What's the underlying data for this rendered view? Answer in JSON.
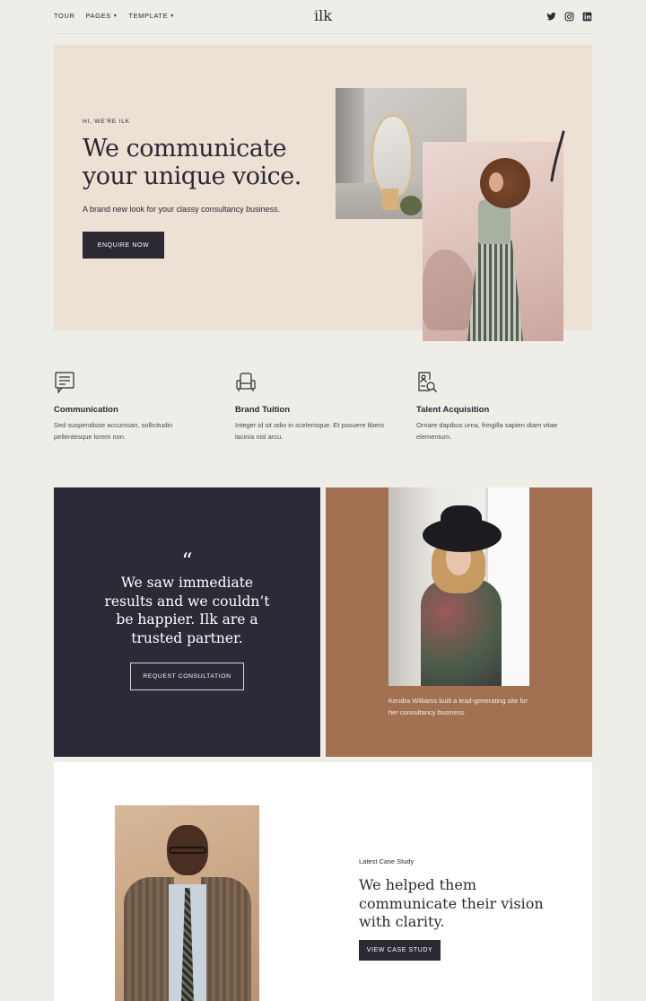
{
  "header": {
    "nav": [
      {
        "label": "TOUR",
        "has_caret": false
      },
      {
        "label": "PAGES",
        "has_caret": true
      },
      {
        "label": "TEMPLATE",
        "has_caret": true
      }
    ],
    "logo": "ilk",
    "social_icons": [
      "twitter-icon",
      "instagram-icon",
      "linkedin-icon"
    ]
  },
  "hero": {
    "eyebrow": "HI, WE'RE ILK",
    "title": "We communicate your unique voice.",
    "subtitle": "A brand new look for your classy consultancy business.",
    "button": "ENQUIRE NOW",
    "images": [
      "mirror-photo",
      "woman-striped-pants-photo"
    ]
  },
  "features": [
    {
      "icon": "message-board-icon",
      "title": "Communication",
      "text": "Sed suspendisse accumsan, sollicitudin pellentesque lorem non."
    },
    {
      "icon": "armchair-icon",
      "title": "Brand Tuition",
      "text": "Integer id sit odio in scelerisque. Et posuere libero lacinia nisl arcu."
    },
    {
      "icon": "document-search-icon",
      "title": "Talent Acquisition",
      "text": "Ornare dapibus urna, fringilla sapien diam vitae elementum."
    }
  ],
  "testimonial": {
    "quote_mark": "“",
    "quote": "We saw immediate results and we couldn’t be happier. Ilk are a trusted partner.",
    "button": "REQUEST CONSULTATION",
    "caption": "Kendra Williams built a lead-generating site for her consultancy business."
  },
  "case_study": {
    "eyebrow": "Latest Case Study",
    "title": "We helped them communicate their vision with clarity.",
    "button": "VIEW CASE STUDY"
  },
  "colors": {
    "page_bg": "#efede8",
    "hero_bg": "#ede0d4",
    "dark": "#2b2a36",
    "brown": "#a27152",
    "white": "#ffffff"
  }
}
